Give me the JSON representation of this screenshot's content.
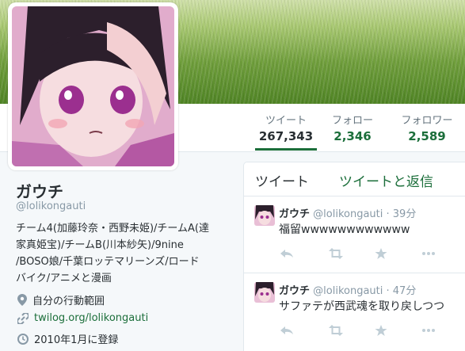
{
  "profile": {
    "name": "ガウチ",
    "handle": "@lolikongauti",
    "bio": [
      "チーム4(加藤玲奈・西野未姫)/チームA(達",
      "家真姫宝)/チームB(川本紗矢)/9nine",
      "/BOSO娘/千葉ロッテマリーンズ/ロード",
      "バイク/アニメと漫画"
    ],
    "location": "自分の行動範囲",
    "url": "twilog.org/lolikongauti",
    "joined": "2010年1月に登録"
  },
  "stats": {
    "tweets": {
      "label": "ツイート",
      "value": "267,343"
    },
    "following": {
      "label": "フォロー",
      "value": "2,346"
    },
    "followers": {
      "label": "フォロワー",
      "value": "2,589"
    }
  },
  "timeline": {
    "tabs": [
      "ツイート",
      "ツイートと返信"
    ],
    "tweets": [
      {
        "name": "ガウチ",
        "handle": "@lolikongauti",
        "time": "· 39分",
        "text": "福留wwwwwwwwwwww"
      },
      {
        "name": "ガウチ",
        "handle": "@lolikongauti",
        "time": "· 47分",
        "text": "サファテが西武魂を取り戻しつつ"
      }
    ]
  },
  "colors": {
    "accent": "#1b6e3a",
    "text": "#292f33",
    "muted": "#8899a6"
  }
}
